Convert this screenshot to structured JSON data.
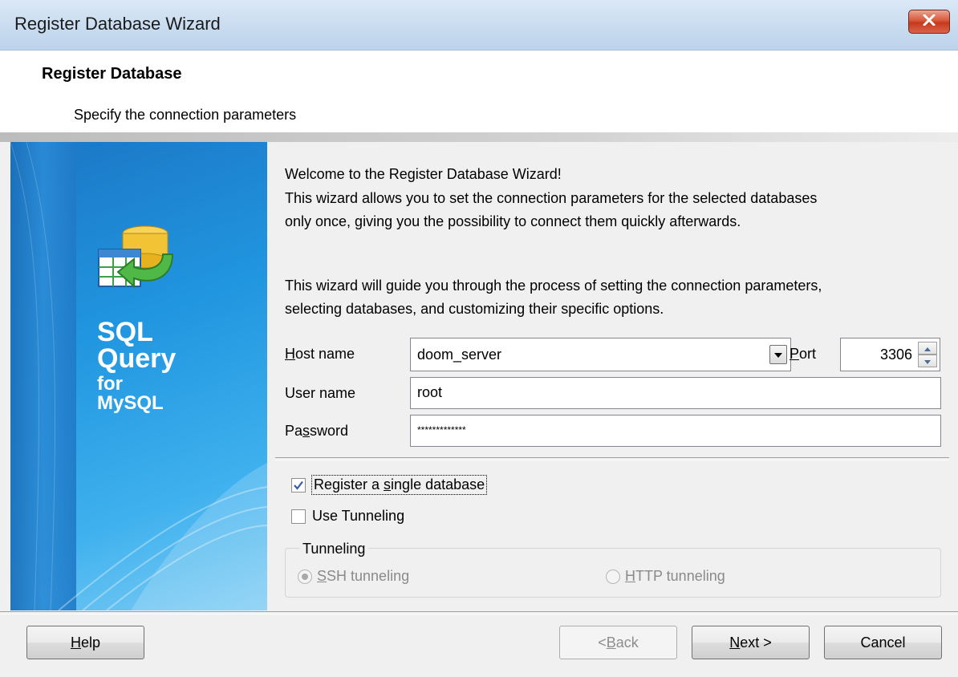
{
  "window": {
    "title": "Register Database Wizard",
    "close_icon": "close-icon"
  },
  "header": {
    "title": "Register Database",
    "subtitle": "Specify the connection parameters"
  },
  "banner": {
    "line1": "SQL",
    "line2": "Query",
    "line3": "for",
    "line4": "MySQL",
    "icon": "database-wizard-icon"
  },
  "intro": {
    "line1": "Welcome to the Register Database Wizard!",
    "line2": "This wizard allows you to set the connection parameters for the selected databases",
    "line3": "only once, giving you the possibility to connect them quickly afterwards.",
    "line4": "This wizard will guide you through the process of setting the connection parameters,",
    "line5": "selecting databases, and customizing their specific options."
  },
  "form": {
    "host_label_first": "H",
    "host_label_rest": "ost name",
    "host_value": "doom_server",
    "port_label_first": "P",
    "port_label_rest": "ort",
    "port_value": "3306",
    "user_label": "User name",
    "user_value": "root",
    "password_label_a": "Pa",
    "password_label_u": "s",
    "password_label_b": "sword",
    "password_value": "*************"
  },
  "options": {
    "single_db_label_a": "Register a ",
    "single_db_label_u": "s",
    "single_db_label_b": "ingle database",
    "single_db_checked": true,
    "tunneling_label": "Use Tunneling",
    "tunneling_checked": false
  },
  "tunneling": {
    "group_title": "Tunneling",
    "ssh_first": "S",
    "ssh_rest": "SH tunneling",
    "http_first": "H",
    "http_rest": "TTP tunneling",
    "selected": "ssh"
  },
  "footer": {
    "help_first": "H",
    "help_rest": "elp",
    "back_pre": "< ",
    "back_first": "B",
    "back_rest": "ack",
    "next_first": "N",
    "next_rest": "ext >",
    "cancel": "Cancel"
  },
  "colors": {
    "banner": "#2196e0",
    "titlebar": "#c9dcf0",
    "close": "#c6391c",
    "check": "#3a5aa8"
  }
}
